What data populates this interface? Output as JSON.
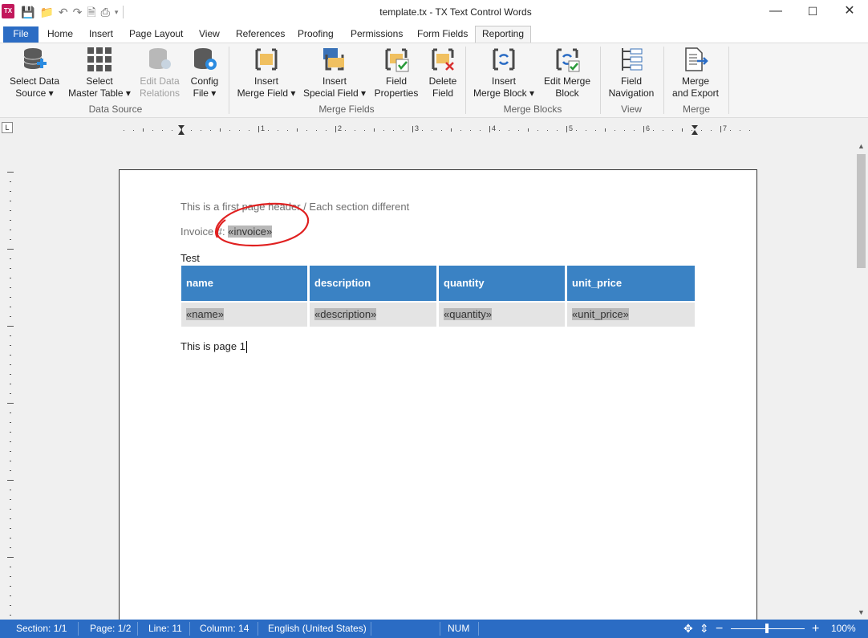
{
  "window": {
    "title": "template.tx - TX Text Control Words",
    "app_icon_text": "TX"
  },
  "tabs": {
    "file": "File",
    "home": "Home",
    "insert": "Insert",
    "page_layout": "Page Layout",
    "view": "View",
    "references": "References",
    "proofing": "Proofing",
    "permissions": "Permissions",
    "form_fields": "Form Fields",
    "reporting": "Reporting"
  },
  "ribbon": {
    "select_data_source": [
      "Select Data",
      "Source ▾"
    ],
    "select_master_table": [
      "Select",
      "Master Table ▾"
    ],
    "edit_data_relations": [
      "Edit Data",
      "Relations"
    ],
    "config_file": [
      "Config",
      "File ▾"
    ],
    "group_data_source": "Data Source",
    "insert_merge_field": [
      "Insert",
      "Merge Field ▾"
    ],
    "insert_special_field": [
      "Insert",
      "Special Field ▾"
    ],
    "field_properties": [
      "Field",
      "Properties"
    ],
    "delete_field": [
      "Delete",
      "Field"
    ],
    "group_merge_fields": "Merge Fields",
    "insert_merge_block": [
      "Insert",
      "Merge Block ▾"
    ],
    "edit_merge_block": [
      "Edit Merge",
      "Block"
    ],
    "group_merge_blocks": "Merge Blocks",
    "field_navigation": [
      "Field",
      "Navigation"
    ],
    "group_view": "View",
    "merge_and_export": [
      "Merge",
      "and Export"
    ],
    "group_merge": "Merge"
  },
  "ruler": {
    "numbers": [
      "1",
      "2",
      "3",
      "4",
      "5",
      "6",
      "7"
    ],
    "tab_selector": "L"
  },
  "document": {
    "header_line": "This is a first page header / Each section different",
    "invoice_label": "Invoice #: ",
    "invoice_field": "«invoice»",
    "test_line": "Test",
    "table_headers": [
      "name",
      "description",
      "quantity",
      "unit_price"
    ],
    "table_fields": [
      "«name»",
      "«description»",
      "«quantity»",
      "«unit_price»"
    ],
    "page_line": "This is page 1"
  },
  "status": {
    "section": "Section: 1/1",
    "page": "Page: 1/2",
    "line": "Line: 11",
    "column": "Column: 14",
    "language": "English (United States)",
    "num": "NUM",
    "zoom": "100%"
  },
  "colors": {
    "accent": "#2b6cc4",
    "table_header": "#3a82c4",
    "annotation": "#e02020"
  }
}
